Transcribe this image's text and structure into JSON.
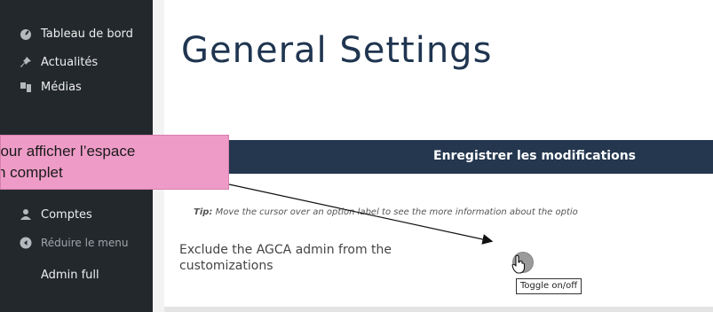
{
  "sidebar": {
    "items": [
      {
        "label": "Tableau de bord",
        "icon": "dashboard-icon"
      },
      {
        "label": "Actualités",
        "icon": "pin-icon"
      },
      {
        "label": "Médias",
        "icon": "media-icon"
      },
      {
        "label": "Comptes",
        "icon": "users-icon"
      },
      {
        "label": "Réduire le menu",
        "icon": "collapse-icon"
      },
      {
        "label": "Admin full",
        "icon": ""
      }
    ]
  },
  "main": {
    "title": "General Settings",
    "save_button": "Enregistrer les modifications",
    "tip_prefix": "Tip:",
    "tip_text": " Move the cursor over an option label to see the more information about the optio",
    "option_label": "Exclude the AGCA admin from the customizations",
    "tooltip": "Toggle on/off"
  },
  "callout": {
    "line1": "pour afficher l’espace",
    "line2": "n complet"
  },
  "colors": {
    "sidebar_bg": "#23282d",
    "header_bar": "#24374f",
    "callout_bg": "#ee9cc7",
    "title": "#1f3550"
  }
}
